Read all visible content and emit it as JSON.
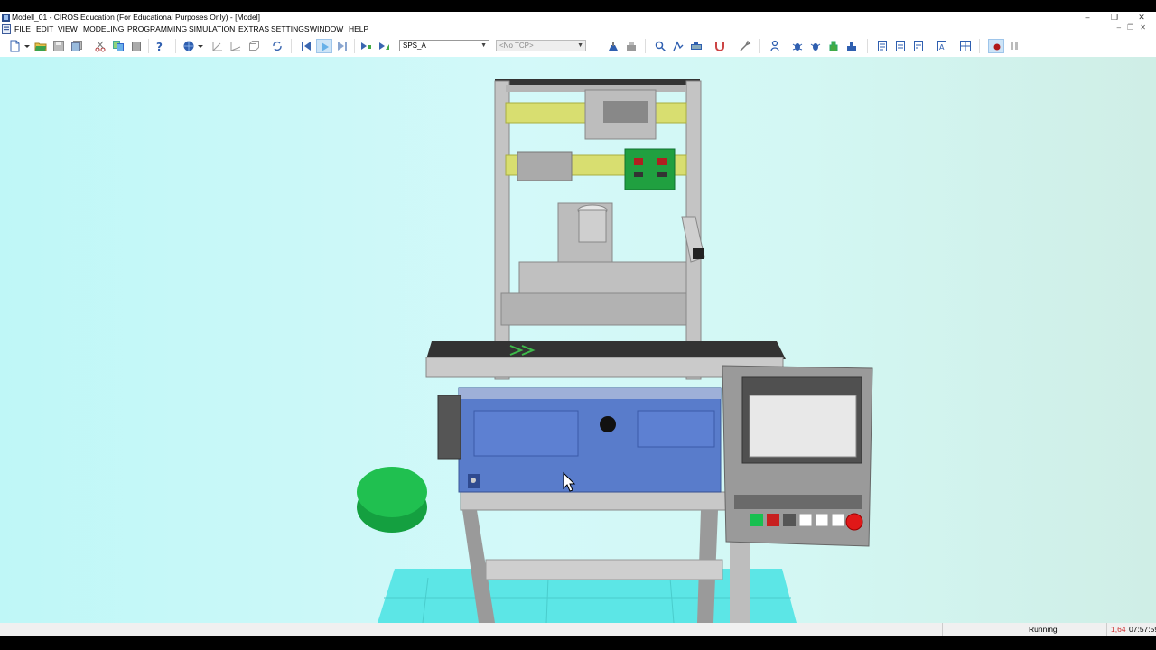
{
  "window": {
    "title": "Modell_01 - CIROS Education (For Educational Purposes Only) - [Model]",
    "controls": [
      "–",
      "❐",
      "✕"
    ]
  },
  "menu": {
    "items": [
      "FILE",
      "EDIT",
      "VIEW",
      "MODELING",
      "PROGRAMMING",
      "SIMULATION",
      "EXTRAS",
      "SETTINGS",
      "WINDOW",
      "HELP"
    ]
  },
  "toolbar": {
    "plc_select": {
      "value": "SPS_A"
    },
    "tcp_select": {
      "value": "<No TCP>"
    },
    "icons": [
      "new-icon",
      "open-icon",
      "save-icon",
      "save-all-icon",
      "cut-icon",
      "copy-icon",
      "paste-icon",
      "help-icon",
      "globe-icon",
      "axis-x-icon",
      "axis-y-icon",
      "axis-z-icon",
      "refresh-icon",
      "step-back-icon",
      "play-icon",
      "step-forward-icon",
      "step-icon",
      "run-icon"
    ]
  },
  "status": {
    "state": "Running",
    "value": "1,64",
    "time": "07:57:59"
  },
  "colors": {
    "viewport_bg": "#c9f7f7",
    "panel_blue": "#4f72c8",
    "button_green": "#18c050",
    "emergency_red": "#e01818",
    "status_value_red": "#d03030"
  }
}
